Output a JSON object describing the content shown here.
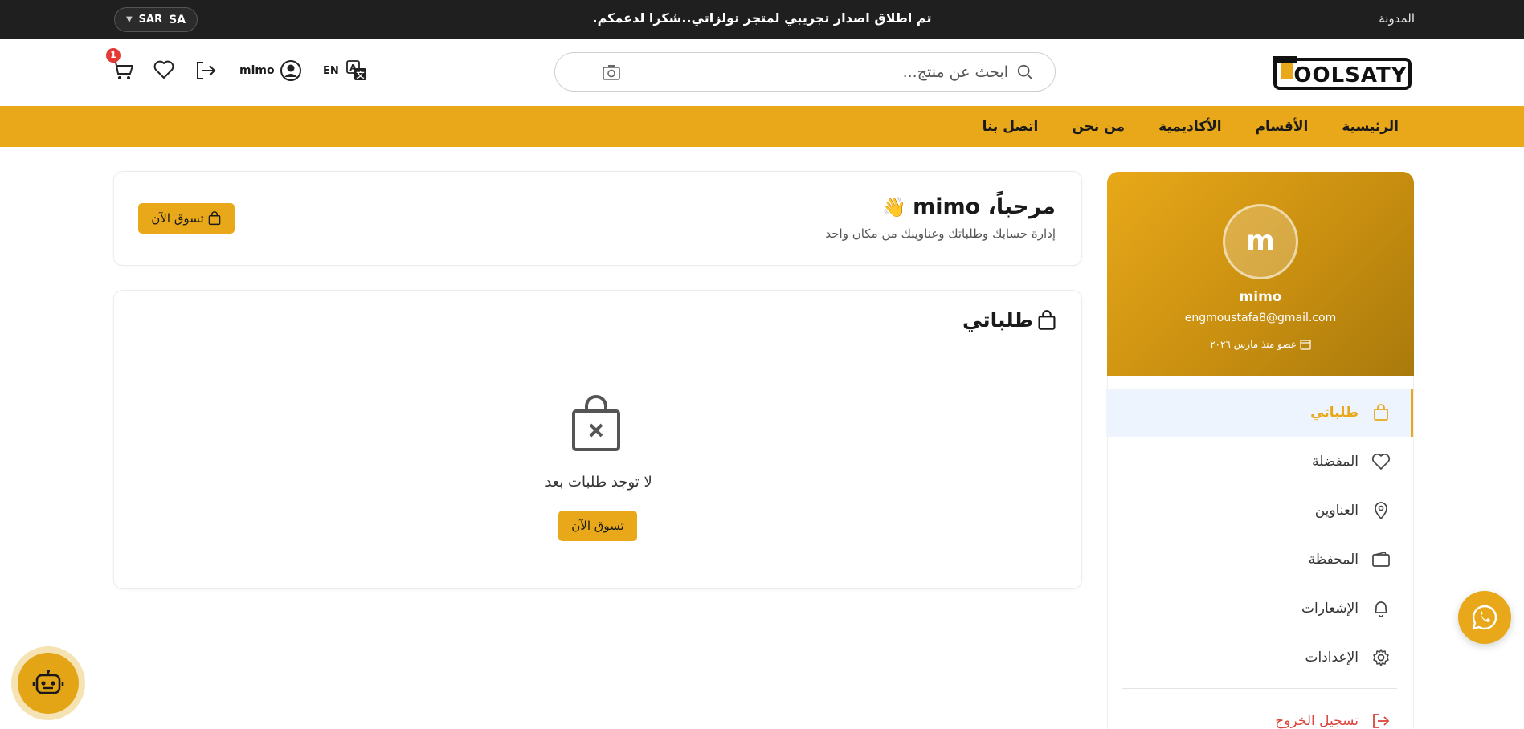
{
  "topbar": {
    "blog_label": "المدونة",
    "announcement": "تم اطلاق اصدار تجريبي لمتجر تولزاتي..شكرا لدعمكم.",
    "currency": "SAR",
    "country_code": "SA"
  },
  "header": {
    "logo_text": "TOOLSATY",
    "search_placeholder": "ابحث عن منتج...",
    "language_label": "EN",
    "username": "mimo",
    "cart_count": "1"
  },
  "nav": {
    "items": [
      "الرئيسية",
      "الأقسام",
      "الأكاديمية",
      "من نحن",
      "اتصل بنا"
    ]
  },
  "profile": {
    "initial": "m",
    "name": "mimo",
    "email": "engmoustafa8@gmail.com",
    "member_since": "عضو منذ مارس ٢٠٢٦"
  },
  "side_menu": {
    "items": [
      {
        "label": "طلباتي",
        "icon": "bag-icon",
        "active": true
      },
      {
        "label": "المفضلة",
        "icon": "heart-icon"
      },
      {
        "label": "العناوين",
        "icon": "location-pin-icon"
      },
      {
        "label": "المحفظة",
        "icon": "wallet-icon"
      },
      {
        "label": "الإشعارات",
        "icon": "bell-icon"
      },
      {
        "label": "الإعدادات",
        "icon": "gear-icon"
      }
    ],
    "logout_label": "تسجيل الخروج"
  },
  "welcome": {
    "title": "مرحباً، mimo",
    "emoji": "👋",
    "subtitle": "إدارة حسابك وطلباتك وعناوينك من مكان واحد",
    "shop_button": "تسوق الآن"
  },
  "orders": {
    "title": "طلباتي",
    "empty_text": "لا توجد طلبات بعد",
    "shop_button": "تسوق الآن"
  },
  "colors": {
    "accent": "#e8a819",
    "topbar": "#1f1f1f",
    "danger": "#d9453b",
    "badge": "#e53935"
  }
}
